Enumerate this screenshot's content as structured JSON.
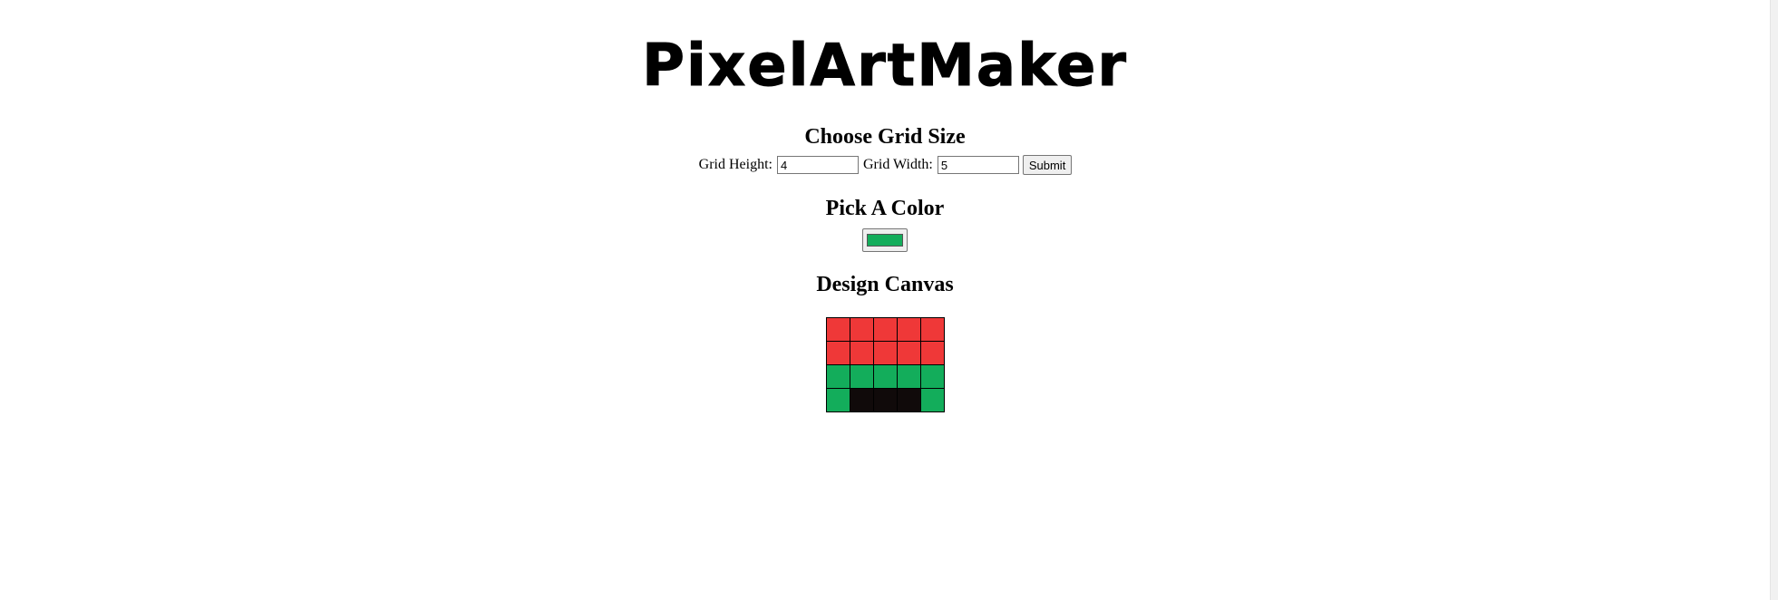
{
  "logo": {
    "text": "PixelArtMaker",
    "color": "#000000"
  },
  "grid_section": {
    "title": "Choose Grid Size",
    "height_label": "Grid Height:",
    "height_value": "4",
    "width_label": "Grid Width:",
    "width_value": "5",
    "submit_label": "Submit"
  },
  "color_section": {
    "title": "Pick A Color",
    "selected_color": "#13ad5b"
  },
  "canvas_section": {
    "title": "Design Canvas",
    "rows": [
      [
        "#ef3838",
        "#ef3838",
        "#ef3838",
        "#ef3838",
        "#ef3838"
      ],
      [
        "#ef3838",
        "#ef3838",
        "#ef3838",
        "#ef3838",
        "#ef3838"
      ],
      [
        "#13ad5b",
        "#13ad5b",
        "#13ad5b",
        "#13ad5b",
        "#13ad5b"
      ],
      [
        "#13ad5b",
        "#100a0a",
        "#100a0a",
        "#100a0a",
        "#13ad5b"
      ]
    ]
  }
}
